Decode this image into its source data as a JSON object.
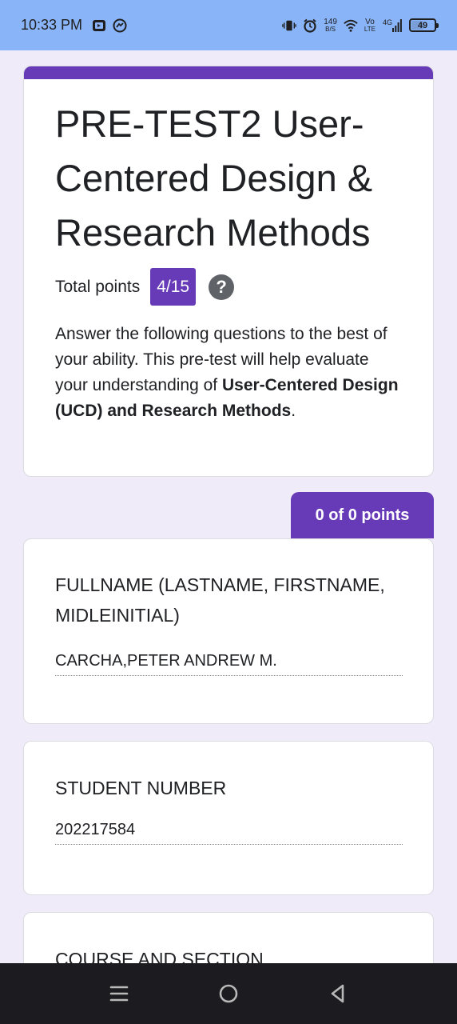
{
  "status_bar": {
    "time": "10:33 PM",
    "net_speed_value": "149",
    "net_speed_unit": "B/S",
    "volte_top": "Vo",
    "volte_bottom": "LTE",
    "network": "4G",
    "battery": "49",
    "left_icons": [
      "media-app-icon",
      "messenger-icon"
    ],
    "right_icons": [
      "vibrate-icon",
      "alarm-icon",
      "wifi-icon",
      "signal-icon",
      "battery-icon"
    ]
  },
  "form": {
    "title": "PRE-TEST2 User-Centered Design & Research Methods",
    "points_label": "Total points",
    "points_value": "4/15",
    "help": "?",
    "description_intro": " Answer the following questions to the best of your ability. This pre-test will help evaluate your understanding of ",
    "description_bold": "User-Centered Design (UCD) and Research Methods",
    "description_end": "."
  },
  "section": {
    "points": "0 of 0 points"
  },
  "questions": [
    {
      "title": "FULLNAME (LASTNAME, FIRSTNAME, MIDLEINITIAL)",
      "answer": "CARCHA,PETER ANDREW M."
    },
    {
      "title": "STUDENT NUMBER",
      "answer": "202217584"
    },
    {
      "title": "COURSE AND SECTION"
    }
  ],
  "colors": {
    "accent": "#673ab7",
    "background": "#f0ebf8",
    "status_bar": "#8ab4f8",
    "nav_bar": "#1c1b1f"
  },
  "nav_bar": {
    "icons": [
      "menu-icon",
      "home-icon",
      "back-icon"
    ]
  }
}
